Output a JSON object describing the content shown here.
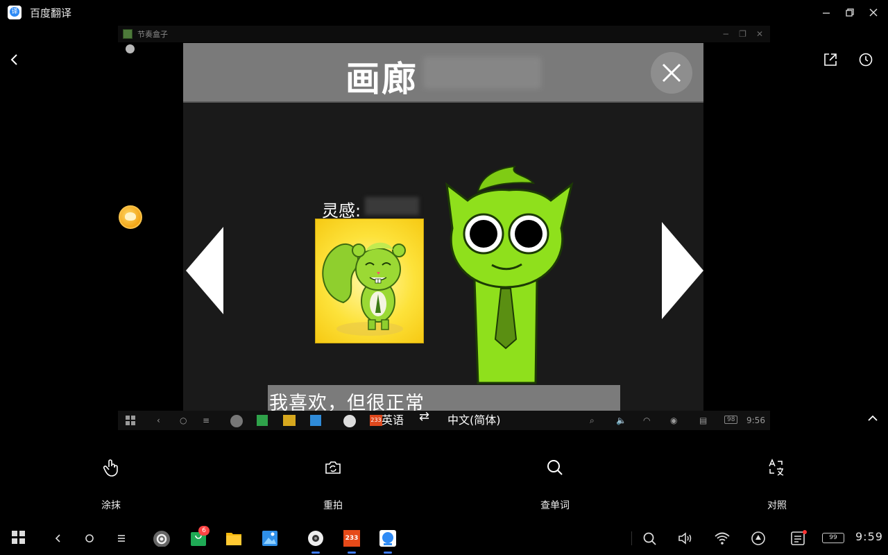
{
  "window": {
    "title": "百度翻译"
  },
  "captured_window": {
    "title": "节奏盒子",
    "game": {
      "header_title": "画廊",
      "inspiration_label": "灵感:",
      "subtitle": "我喜欢，但很正常"
    },
    "taskbar_clock": "9:56",
    "taskbar_battery": "98",
    "taskbar_233": "233"
  },
  "translation": {
    "source_language": "英语",
    "swap_symbol": "⇄",
    "target_language": "中文(简体)"
  },
  "tools": [
    {
      "label": "涂抹",
      "icon": "hand-pointer-icon"
    },
    {
      "label": "重拍",
      "icon": "camera-retake-icon"
    },
    {
      "label": "查单词",
      "icon": "search-icon"
    },
    {
      "label": "对照",
      "icon": "compare-translate-icon"
    }
  ],
  "system_taskbar": {
    "clock": "9:59",
    "battery": "99",
    "badge_count": "6",
    "app_233": "233"
  }
}
